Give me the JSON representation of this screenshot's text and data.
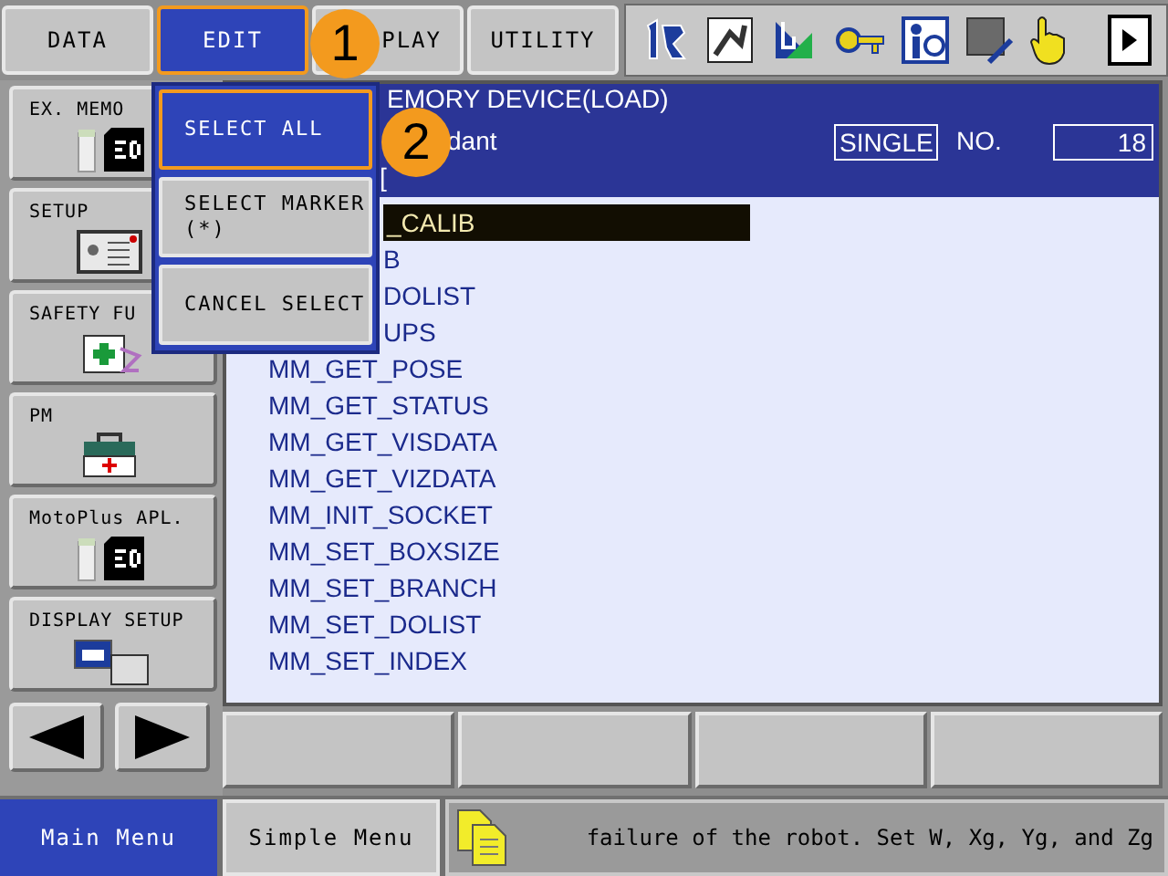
{
  "menu_tabs": [
    {
      "label": "DATA",
      "selected": false
    },
    {
      "label": "EDIT",
      "selected": true
    },
    {
      "label": "PLAY",
      "selected": false
    },
    {
      "label": "UTILITY",
      "selected": false
    }
  ],
  "edit_menu": [
    {
      "label": "SELECT ALL",
      "selected": true
    },
    {
      "label": "SELECT MARKER\n(*)",
      "selected": false
    },
    {
      "label": "CANCEL SELECT",
      "selected": false
    }
  ],
  "side_menu": [
    {
      "label": "EX. MEMO",
      "kind": "sd"
    },
    {
      "label": "SETUP",
      "kind": "setup"
    },
    {
      "label": "SAFETY FU",
      "kind": "safety"
    },
    {
      "label": "PM",
      "kind": "pm"
    },
    {
      "label": "MotoPlus APL.",
      "kind": "sd"
    },
    {
      "label": "DISPLAY SETUP",
      "kind": "display"
    }
  ],
  "content": {
    "title": "EMORY DEVICE(LOAD)",
    "line_2": "dant",
    "line_3": "[",
    "mode": "SINGLE",
    "no_label": "NO.",
    "number": "18",
    "files": [
      {
        "name": "_CALIB",
        "kind": "clipped",
        "selected": true
      },
      {
        "name": "B",
        "kind": "clipped",
        "selected": false
      },
      {
        "name": "DOLIST",
        "kind": "clipped",
        "selected": false
      },
      {
        "name": "UPS",
        "kind": "clipped",
        "selected": false
      },
      {
        "name": "MM_GET_POSE",
        "kind": "full",
        "selected": false
      },
      {
        "name": "MM_GET_STATUS",
        "kind": "full",
        "selected": false
      },
      {
        "name": "MM_GET_VISDATA",
        "kind": "full",
        "selected": false
      },
      {
        "name": "MM_GET_VIZDATA",
        "kind": "full",
        "selected": false
      },
      {
        "name": "MM_INIT_SOCKET",
        "kind": "full",
        "selected": false
      },
      {
        "name": "MM_SET_BOXSIZE",
        "kind": "full",
        "selected": false
      },
      {
        "name": "MM_SET_BRANCH",
        "kind": "full",
        "selected": false
      },
      {
        "name": "MM_SET_DOLIST",
        "kind": "full",
        "selected": false
      },
      {
        "name": "MM_SET_INDEX",
        "kind": "full",
        "selected": false
      }
    ]
  },
  "bottom_bar": {
    "main_menu": {
      "label": "Main Menu",
      "selected": true
    },
    "simple_menu": {
      "label": "Simple Menu",
      "selected": false
    },
    "message": "failure of the robot. Set W, Xg, Yg, and Zg"
  },
  "annotations": [
    {
      "label": "1"
    },
    {
      "label": "2"
    }
  ]
}
